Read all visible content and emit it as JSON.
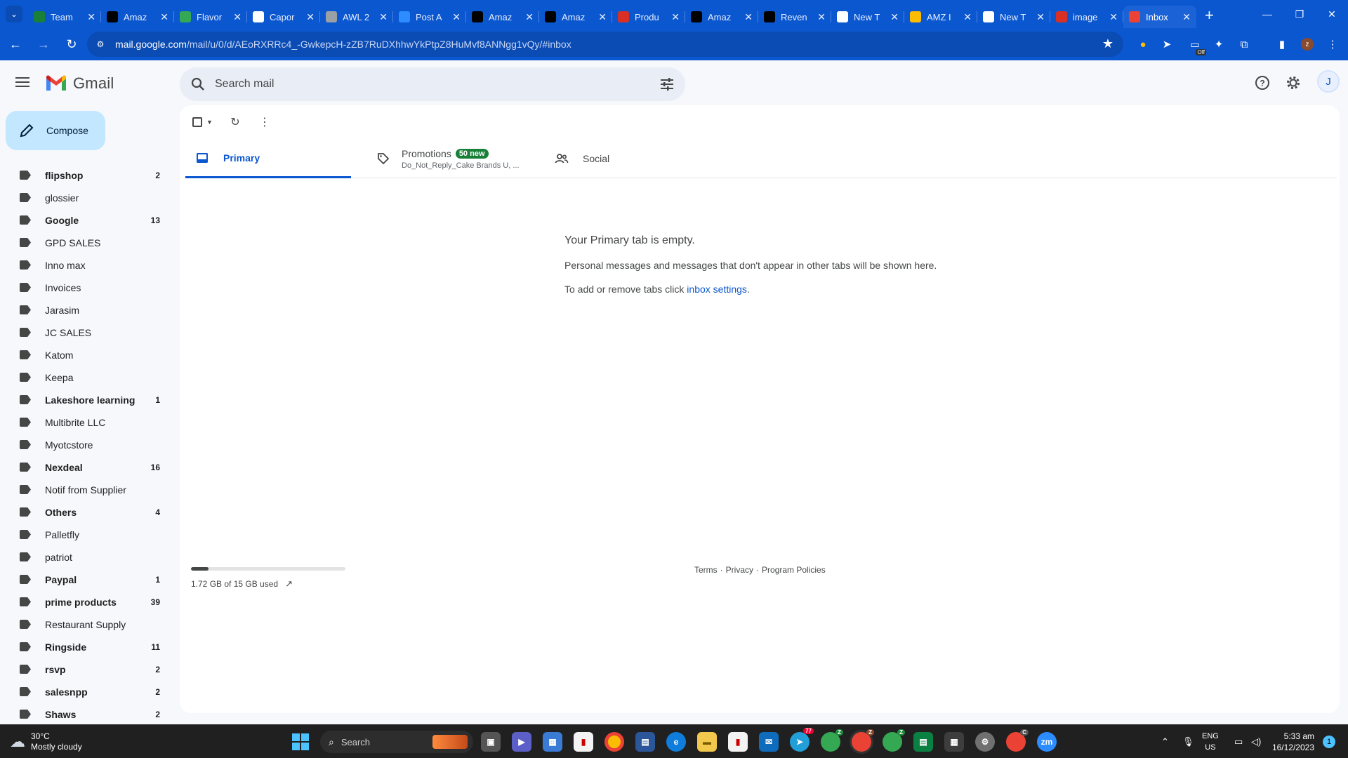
{
  "browser": {
    "tabs": [
      {
        "title": "Team",
        "icon": "sheets-icon",
        "color": "#188038"
      },
      {
        "title": "Amaz",
        "icon": "amazon-icon",
        "color": "#000000"
      },
      {
        "title": "Flavor",
        "icon": "wix-icon",
        "color": "#34a853"
      },
      {
        "title": "Capor",
        "icon": "google-icon",
        "color": "#ffffff"
      },
      {
        "title": "AWL 2",
        "icon": "globe-icon",
        "color": "#9aa0a6"
      },
      {
        "title": "Post A",
        "icon": "zoom-icon",
        "color": "#2d8cff"
      },
      {
        "title": "Amaz",
        "icon": "amazon-icon",
        "color": "#000000"
      },
      {
        "title": "Amaz",
        "icon": "amazon-icon",
        "color": "#000000"
      },
      {
        "title": "Produ",
        "icon": "brand-icon",
        "color": "#d93025"
      },
      {
        "title": "Amaz",
        "icon": "amazon-icon",
        "color": "#000000"
      },
      {
        "title": "Reven",
        "icon": "amazon-icon",
        "color": "#000000"
      },
      {
        "title": "New T",
        "icon": "chrome-icon",
        "color": "#ffffff"
      },
      {
        "title": "AMZ I",
        "icon": "pen-icon",
        "color": "#fbbc04"
      },
      {
        "title": "New T",
        "icon": "chrome-icon",
        "color": "#ffffff"
      },
      {
        "title": "image",
        "icon": "brand-icon",
        "color": "#d93025"
      },
      {
        "title": "Inbox",
        "icon": "gmail-icon",
        "color": "#ea4335",
        "active": true
      }
    ],
    "url_host": "mail.google.com",
    "url_path": "/mail/u/0/d/AEoRXRRc4_-GwkepcH-zZB7RuDXhhwYkPtpZ8HuMvf8ANNgg1vQy/#inbox",
    "ext_badge": "Off",
    "profile_initial": "z"
  },
  "gmail": {
    "brand": "Gmail",
    "search_placeholder": "Search mail",
    "avatar_initial": "J",
    "compose_label": "Compose",
    "labels": [
      {
        "name": "flipshop",
        "count": "2",
        "bold": true
      },
      {
        "name": "glossier",
        "count": "",
        "bold": false
      },
      {
        "name": "Google",
        "count": "13",
        "bold": true
      },
      {
        "name": "GPD SALES",
        "count": "",
        "bold": false
      },
      {
        "name": "Inno max",
        "count": "",
        "bold": false
      },
      {
        "name": "Invoices",
        "count": "",
        "bold": false
      },
      {
        "name": "Jarasim",
        "count": "",
        "bold": false
      },
      {
        "name": "JC SALES",
        "count": "",
        "bold": false
      },
      {
        "name": "Katom",
        "count": "",
        "bold": false
      },
      {
        "name": "Keepa",
        "count": "",
        "bold": false
      },
      {
        "name": "Lakeshore learning",
        "count": "1",
        "bold": true
      },
      {
        "name": "Multibrite LLC",
        "count": "",
        "bold": false
      },
      {
        "name": "Myotcstore",
        "count": "",
        "bold": false
      },
      {
        "name": "Nexdeal",
        "count": "16",
        "bold": true
      },
      {
        "name": "Notif from Supplier",
        "count": "",
        "bold": false
      },
      {
        "name": "Others",
        "count": "4",
        "bold": true
      },
      {
        "name": "Palletfly",
        "count": "",
        "bold": false
      },
      {
        "name": "patriot",
        "count": "",
        "bold": false
      },
      {
        "name": "Paypal",
        "count": "1",
        "bold": true
      },
      {
        "name": "prime products",
        "count": "39",
        "bold": true
      },
      {
        "name": "Restaurant Supply",
        "count": "",
        "bold": false
      },
      {
        "name": "Ringside",
        "count": "11",
        "bold": true
      },
      {
        "name": "rsvp",
        "count": "2",
        "bold": true
      },
      {
        "name": "salesnpp",
        "count": "2",
        "bold": true
      },
      {
        "name": "Shaws",
        "count": "2",
        "bold": true
      }
    ],
    "tabs": {
      "primary": "Primary",
      "promotions": "Promotions",
      "promotions_badge": "50 new",
      "promotions_sub": "Do_Not_Reply_Cake Brands U, ...",
      "social": "Social"
    },
    "empty": {
      "heading": "Your Primary tab is empty.",
      "line1": "Personal messages and messages that don't appear in other tabs will be shown here.",
      "line2_prefix": "To add or remove tabs click ",
      "line2_link": "inbox settings",
      "line2_suffix": "."
    },
    "storage": {
      "text": "1.72 GB of 15 GB used",
      "used_fraction": 0.115
    },
    "footer": {
      "terms": "Terms",
      "privacy": "Privacy",
      "policies": "Program Policies",
      "sep": "·"
    }
  },
  "taskbar": {
    "weather_temp": "30°C",
    "weather_desc": "Mostly cloudy",
    "search_label": "Search",
    "lang_line1": "ENG",
    "lang_line2": "US",
    "time": "5:33 am",
    "date": "16/12/2023",
    "notification_count": "1",
    "badge_teams": "77",
    "badge_chrome1": "Z",
    "badge_chrome2": "Z",
    "badge_chrome3": "Z",
    "badge_chrome4": "C",
    "accent": "#4cc2ff"
  }
}
